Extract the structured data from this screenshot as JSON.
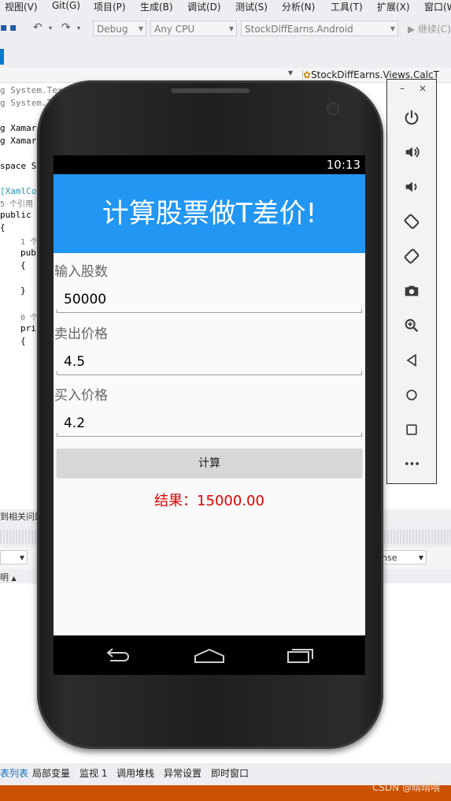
{
  "ide": {
    "menu": [
      "视图(V)",
      "Git(G)",
      "项目(P)",
      "生成(B)",
      "调试(D)",
      "测试(S)",
      "分析(N)",
      "工具(T)",
      "扩展(X)",
      "窗口(W)"
    ],
    "toolbar": {
      "config": "Debug",
      "platform": "Any CPU",
      "project": "StockDiffEarns.Android",
      "continue_label": "继续(C)"
    },
    "nav_right": "StockDiffEarns.Views.CalcT",
    "code_lines": {
      "l1": "g System.Text",
      "l2": "g System.T",
      "l3": "g Xamar",
      "l4": "g Xamar",
      "l5": "space S",
      "l6": "[XamlCo",
      "l7": "5 个引用",
      "l8": "public",
      "l9": "{",
      "l10": "1 个",
      "l11": "pub",
      "l12": "{",
      "l13": "}",
      "l14": "0 个",
      "l15": "pri",
      "l16": "{"
    },
    "status_strip": "到相关问题",
    "panel_combo_right": "nse",
    "panel_label": "明",
    "bottom_tabs": [
      "表列表",
      "局部变量",
      "监视 1",
      "调用堆栈",
      "异常设置",
      "即时窗口"
    ],
    "watermark": "CSDN @晴晴喂"
  },
  "emulator_toolbar": {
    "minimize": "–",
    "close": "×",
    "buttons": [
      "power-icon",
      "volume-up-icon",
      "volume-down-icon",
      "rotate-left-icon",
      "rotate-right-icon",
      "camera-icon",
      "zoom-icon",
      "back-icon",
      "home-icon",
      "overview-icon",
      "more-icon"
    ],
    "more": "•••"
  },
  "app": {
    "time": "10:13",
    "title": "计算股票做T差价!",
    "shares_label": "输入股数",
    "shares_value": "50000",
    "sell_label": "卖出价格",
    "sell_value": "4.5",
    "buy_label": "买入价格",
    "buy_value": "4.2",
    "calc_button": "计算",
    "result": "结果：15000.00",
    "accent_color": "#2196f3",
    "result_color": "#e00000"
  }
}
